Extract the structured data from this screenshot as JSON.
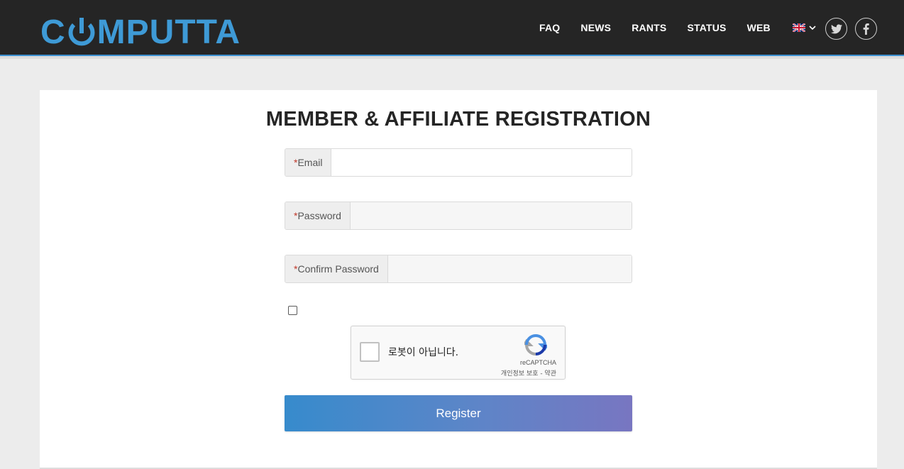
{
  "header": {
    "logo_text_before": "C",
    "logo_text_after": "MPUTTA",
    "nav": [
      {
        "label": "FAQ"
      },
      {
        "label": "NEWS"
      },
      {
        "label": "RANTS"
      },
      {
        "label": "STATUS"
      },
      {
        "label": "WEB"
      }
    ],
    "language_icon": "uk-flag-icon",
    "social": [
      {
        "icon": "twitter-icon"
      },
      {
        "icon": "facebook-icon"
      }
    ]
  },
  "form": {
    "title": "MEMBER & AFFILIATE REGISTRATION",
    "required_mark": "*",
    "email_label": "Email",
    "email_value": "",
    "password_label": "Password",
    "password_value": "",
    "confirm_label": "Confirm Password",
    "confirm_value": "",
    "terms_checked": false,
    "submit_label": "Register"
  },
  "recaptcha": {
    "label": "로봇이 아닙니다.",
    "brand": "reCAPTCHA",
    "links": "개인정보 보호 - 약관"
  },
  "colors": {
    "brand": "#3e9ad6",
    "header_bg": "#252525",
    "button_start": "#378bcc",
    "button_end": "#7876c1",
    "required": "#c0392b"
  }
}
